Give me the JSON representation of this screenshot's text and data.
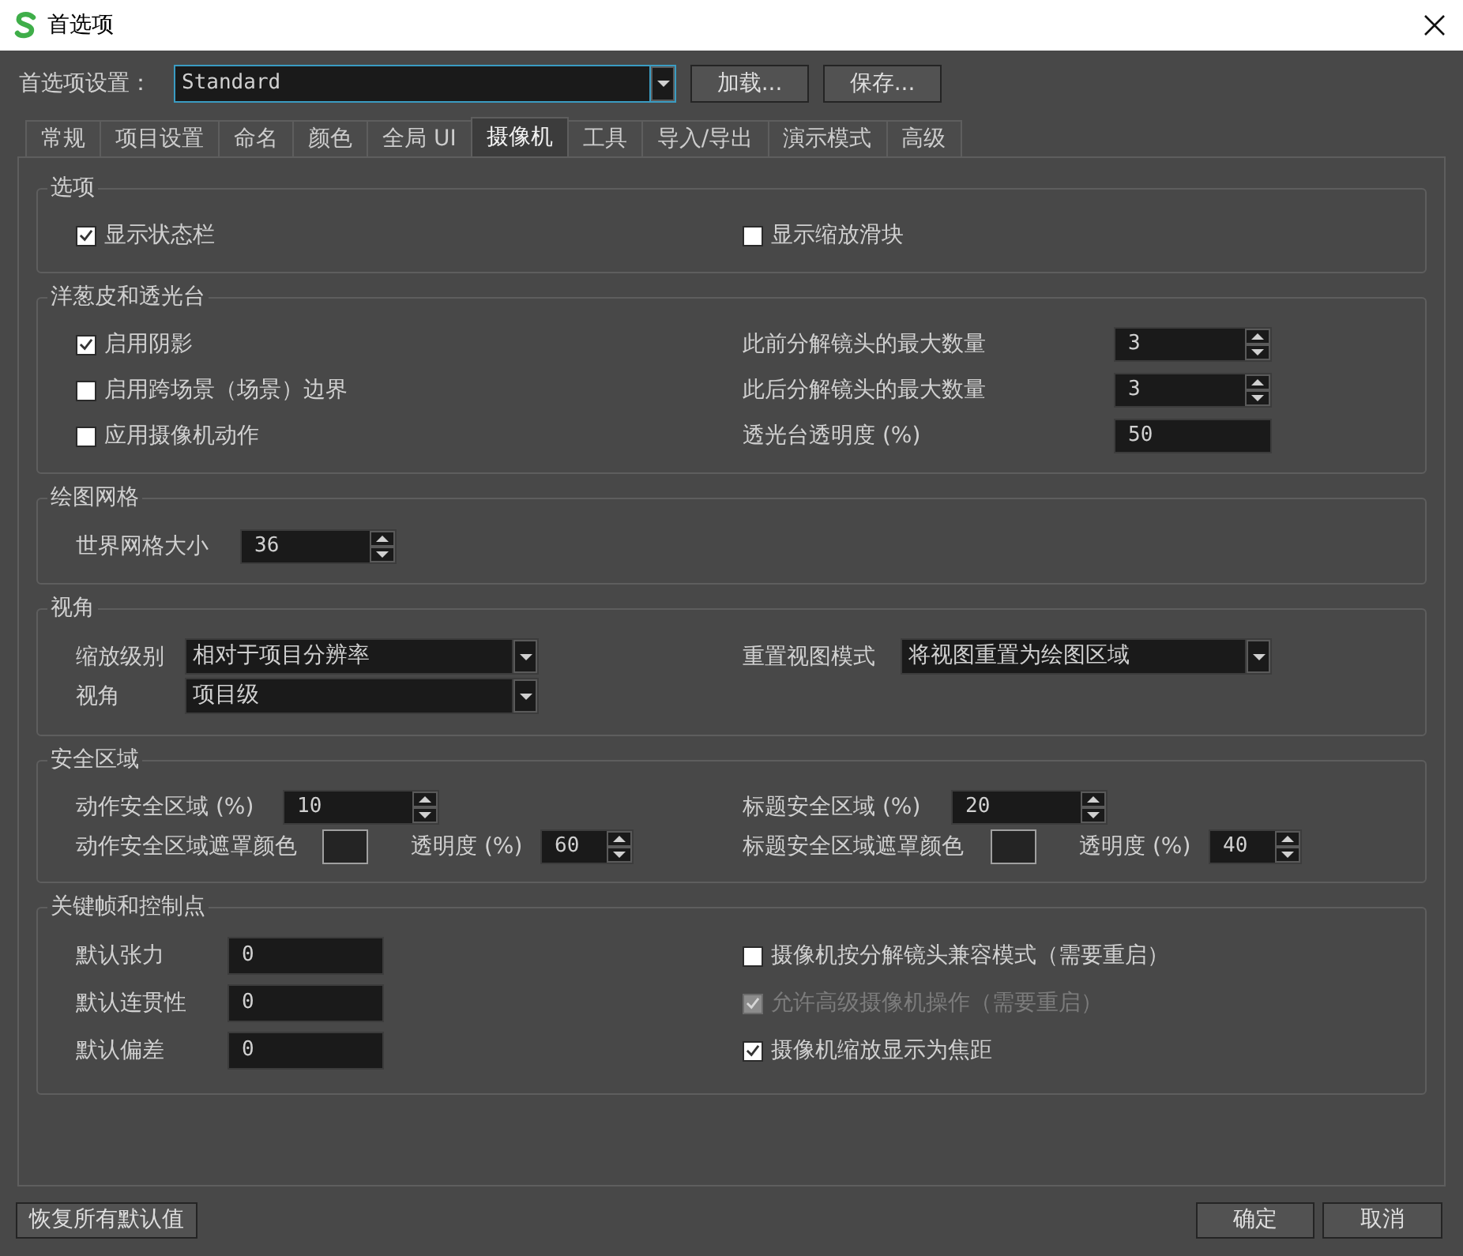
{
  "window": {
    "title": "首选项"
  },
  "preset": {
    "label": "首选项设置：",
    "value": "Standard",
    "buttons": [
      "加载...",
      "保存..."
    ]
  },
  "tabs": [
    {
      "label": "常规",
      "selected": false
    },
    {
      "label": "项目设置",
      "selected": false
    },
    {
      "label": "命名",
      "selected": false
    },
    {
      "label": "颜色",
      "selected": false
    },
    {
      "label": "全局 UI",
      "selected": false
    },
    {
      "label": "摄像机",
      "selected": true
    },
    {
      "label": "工具",
      "selected": false
    },
    {
      "label": "导入/导出",
      "selected": false
    },
    {
      "label": "演示模式",
      "selected": false
    },
    {
      "label": "高级",
      "selected": false
    }
  ],
  "groups": [
    {
      "title": "选项",
      "left": [
        {
          "kind": "checkbox",
          "label": "显示状态栏",
          "checked": true,
          "disabled": false
        }
      ],
      "right": [
        {
          "kind": "checkbox",
          "label": "显示缩放滑块",
          "checked": false,
          "disabled": false
        }
      ]
    },
    {
      "title": "洋葱皮和透光台",
      "left": [
        {
          "kind": "checkbox",
          "label": "启用阴影",
          "checked": true,
          "disabled": false
        },
        {
          "kind": "checkbox",
          "label": "启用跨场景（场景）边界",
          "checked": false,
          "disabled": false
        },
        {
          "kind": "checkbox",
          "label": "应用摄像机动作",
          "checked": false,
          "disabled": false
        }
      ],
      "right": [
        {
          "kind": "spinbox",
          "label": "此前分解镜头的最大数量",
          "value": "3"
        },
        {
          "kind": "spinbox",
          "label": "此后分解镜头的最大数量",
          "value": "3"
        },
        {
          "kind": "field",
          "label": "透光台透明度 (%)",
          "value": "50"
        }
      ]
    },
    {
      "title": "绘图网格",
      "left": [
        {
          "kind": "spinbox",
          "label": "世界网格大小",
          "value": "36"
        }
      ]
    },
    {
      "title": "视角",
      "left": [
        {
          "kind": "combo",
          "label": "缩放级别",
          "value": "相对于项目分辨率"
        },
        {
          "kind": "combo",
          "label": "视角",
          "value": "项目级"
        }
      ],
      "right": [
        {
          "kind": "combo",
          "label": "重置视图模式",
          "value": "将视图重置为绘图区域"
        }
      ]
    },
    {
      "title": "安全区域",
      "left": [
        {
          "kind": "spinbox",
          "label": "动作安全区域 (%)",
          "value": "10"
        },
        {
          "kind": "mask",
          "label": "动作安全区域遮罩颜色",
          "color": "#242424",
          "opacity_label": "透明度 (%)",
          "opacity": "60"
        }
      ],
      "right": [
        {
          "kind": "spinbox",
          "label": "标题安全区域 (%)",
          "value": "20"
        },
        {
          "kind": "mask",
          "label": "标题安全区域遮罩颜色",
          "color": "#242424",
          "opacity_label": "透明度 (%)",
          "opacity": "40"
        }
      ]
    },
    {
      "title": "关键帧和控制点",
      "left": [
        {
          "kind": "field",
          "label": "默认张力",
          "value": "0"
        },
        {
          "kind": "field",
          "label": "默认连贯性",
          "value": "0"
        },
        {
          "kind": "field",
          "label": "默认偏差",
          "value": "0"
        }
      ],
      "right": [
        {
          "kind": "checkbox",
          "label": "摄像机按分解镜头兼容模式（需要重启）",
          "checked": false,
          "disabled": false
        },
        {
          "kind": "checkbox",
          "label": "允许高级摄像机操作（需要重启）",
          "checked": true,
          "disabled": true
        },
        {
          "kind": "checkbox",
          "label": "摄像机缩放显示为焦距",
          "checked": true,
          "disabled": false
        }
      ]
    }
  ],
  "footer": {
    "reset_button": "恢复所有默认值",
    "buttons": [
      "确定",
      "取消"
    ]
  }
}
